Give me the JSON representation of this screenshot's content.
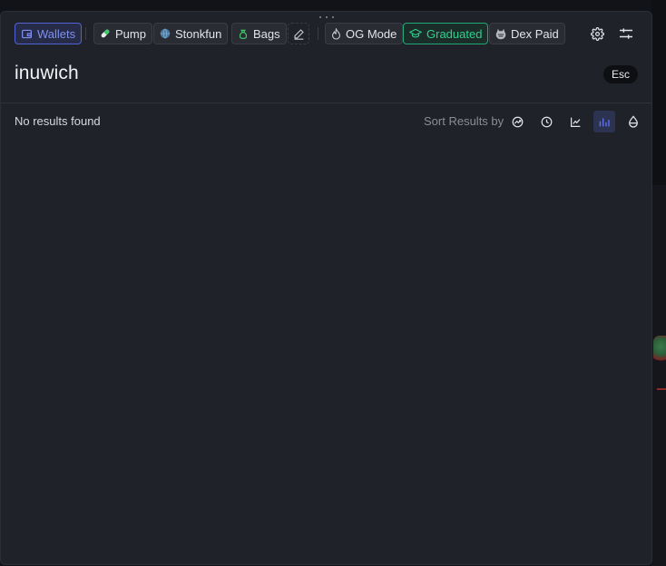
{
  "toolbar": {
    "chips": {
      "wallets": "Wallets",
      "pump": "Pump",
      "stonkfun": "Stonkfun",
      "bags": "Bags",
      "og_mode": "OG Mode",
      "graduated": "Graduated",
      "dex_paid": "Dex Paid"
    },
    "icons": {
      "wallets": "wallet-icon",
      "pump": "pill-icon",
      "stonkfun": "stonkfun-globe-icon",
      "bags": "money-bag-icon",
      "edit": "pencil-icon",
      "og_mode": "flame-icon",
      "graduated": "graduation-cap-icon",
      "dex_paid": "dex-screener-icon",
      "settings": "gear-icon",
      "filters": "sliders-icon"
    }
  },
  "search": {
    "query": "inuwich",
    "close_hint": "Esc"
  },
  "results": {
    "status": "No results found",
    "sort_label": "Sort Results by",
    "sort_options": [
      {
        "icon": "trending-icon",
        "active": false
      },
      {
        "icon": "clock-icon",
        "active": false
      },
      {
        "icon": "line-chart-icon",
        "active": false
      },
      {
        "icon": "bar-chart-icon",
        "active": true
      },
      {
        "icon": "droplet-icon",
        "active": false
      }
    ]
  },
  "colors": {
    "modal_bg": "#202229",
    "accent_blue": "#5163d6",
    "accent_green": "#22a877",
    "text_muted": "#8a8d96"
  }
}
